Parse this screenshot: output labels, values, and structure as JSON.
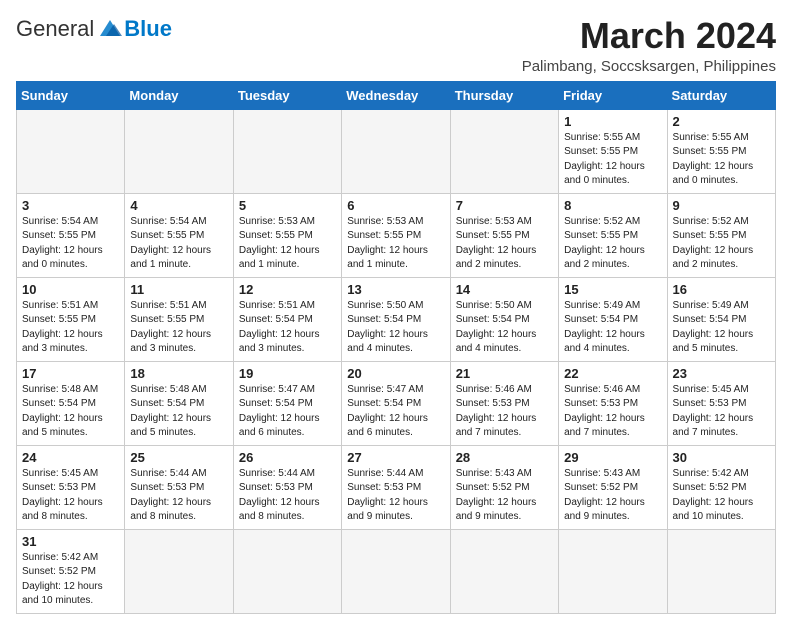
{
  "header": {
    "logo_general": "General",
    "logo_blue": "Blue",
    "month_year": "March 2024",
    "subtitle": "Palimbang, Soccsksargen, Philippines"
  },
  "weekdays": [
    "Sunday",
    "Monday",
    "Tuesday",
    "Wednesday",
    "Thursday",
    "Friday",
    "Saturday"
  ],
  "weeks": [
    [
      {
        "day": "",
        "info": ""
      },
      {
        "day": "",
        "info": ""
      },
      {
        "day": "",
        "info": ""
      },
      {
        "day": "",
        "info": ""
      },
      {
        "day": "",
        "info": ""
      },
      {
        "day": "1",
        "info": "Sunrise: 5:55 AM\nSunset: 5:55 PM\nDaylight: 12 hours\nand 0 minutes."
      },
      {
        "day": "2",
        "info": "Sunrise: 5:55 AM\nSunset: 5:55 PM\nDaylight: 12 hours\nand 0 minutes."
      }
    ],
    [
      {
        "day": "3",
        "info": "Sunrise: 5:54 AM\nSunset: 5:55 PM\nDaylight: 12 hours\nand 0 minutes."
      },
      {
        "day": "4",
        "info": "Sunrise: 5:54 AM\nSunset: 5:55 PM\nDaylight: 12 hours\nand 1 minute."
      },
      {
        "day": "5",
        "info": "Sunrise: 5:53 AM\nSunset: 5:55 PM\nDaylight: 12 hours\nand 1 minute."
      },
      {
        "day": "6",
        "info": "Sunrise: 5:53 AM\nSunset: 5:55 PM\nDaylight: 12 hours\nand 1 minute."
      },
      {
        "day": "7",
        "info": "Sunrise: 5:53 AM\nSunset: 5:55 PM\nDaylight: 12 hours\nand 2 minutes."
      },
      {
        "day": "8",
        "info": "Sunrise: 5:52 AM\nSunset: 5:55 PM\nDaylight: 12 hours\nand 2 minutes."
      },
      {
        "day": "9",
        "info": "Sunrise: 5:52 AM\nSunset: 5:55 PM\nDaylight: 12 hours\nand 2 minutes."
      }
    ],
    [
      {
        "day": "10",
        "info": "Sunrise: 5:51 AM\nSunset: 5:55 PM\nDaylight: 12 hours\nand 3 minutes."
      },
      {
        "day": "11",
        "info": "Sunrise: 5:51 AM\nSunset: 5:55 PM\nDaylight: 12 hours\nand 3 minutes."
      },
      {
        "day": "12",
        "info": "Sunrise: 5:51 AM\nSunset: 5:54 PM\nDaylight: 12 hours\nand 3 minutes."
      },
      {
        "day": "13",
        "info": "Sunrise: 5:50 AM\nSunset: 5:54 PM\nDaylight: 12 hours\nand 4 minutes."
      },
      {
        "day": "14",
        "info": "Sunrise: 5:50 AM\nSunset: 5:54 PM\nDaylight: 12 hours\nand 4 minutes."
      },
      {
        "day": "15",
        "info": "Sunrise: 5:49 AM\nSunset: 5:54 PM\nDaylight: 12 hours\nand 4 minutes."
      },
      {
        "day": "16",
        "info": "Sunrise: 5:49 AM\nSunset: 5:54 PM\nDaylight: 12 hours\nand 5 minutes."
      }
    ],
    [
      {
        "day": "17",
        "info": "Sunrise: 5:48 AM\nSunset: 5:54 PM\nDaylight: 12 hours\nand 5 minutes."
      },
      {
        "day": "18",
        "info": "Sunrise: 5:48 AM\nSunset: 5:54 PM\nDaylight: 12 hours\nand 5 minutes."
      },
      {
        "day": "19",
        "info": "Sunrise: 5:47 AM\nSunset: 5:54 PM\nDaylight: 12 hours\nand 6 minutes."
      },
      {
        "day": "20",
        "info": "Sunrise: 5:47 AM\nSunset: 5:54 PM\nDaylight: 12 hours\nand 6 minutes."
      },
      {
        "day": "21",
        "info": "Sunrise: 5:46 AM\nSunset: 5:53 PM\nDaylight: 12 hours\nand 7 minutes."
      },
      {
        "day": "22",
        "info": "Sunrise: 5:46 AM\nSunset: 5:53 PM\nDaylight: 12 hours\nand 7 minutes."
      },
      {
        "day": "23",
        "info": "Sunrise: 5:45 AM\nSunset: 5:53 PM\nDaylight: 12 hours\nand 7 minutes."
      }
    ],
    [
      {
        "day": "24",
        "info": "Sunrise: 5:45 AM\nSunset: 5:53 PM\nDaylight: 12 hours\nand 8 minutes."
      },
      {
        "day": "25",
        "info": "Sunrise: 5:44 AM\nSunset: 5:53 PM\nDaylight: 12 hours\nand 8 minutes."
      },
      {
        "day": "26",
        "info": "Sunrise: 5:44 AM\nSunset: 5:53 PM\nDaylight: 12 hours\nand 8 minutes."
      },
      {
        "day": "27",
        "info": "Sunrise: 5:44 AM\nSunset: 5:53 PM\nDaylight: 12 hours\nand 9 minutes."
      },
      {
        "day": "28",
        "info": "Sunrise: 5:43 AM\nSunset: 5:52 PM\nDaylight: 12 hours\nand 9 minutes."
      },
      {
        "day": "29",
        "info": "Sunrise: 5:43 AM\nSunset: 5:52 PM\nDaylight: 12 hours\nand 9 minutes."
      },
      {
        "day": "30",
        "info": "Sunrise: 5:42 AM\nSunset: 5:52 PM\nDaylight: 12 hours\nand 10 minutes."
      }
    ],
    [
      {
        "day": "31",
        "info": "Sunrise: 5:42 AM\nSunset: 5:52 PM\nDaylight: 12 hours\nand 10 minutes."
      },
      {
        "day": "",
        "info": ""
      },
      {
        "day": "",
        "info": ""
      },
      {
        "day": "",
        "info": ""
      },
      {
        "day": "",
        "info": ""
      },
      {
        "day": "",
        "info": ""
      },
      {
        "day": "",
        "info": ""
      }
    ]
  ]
}
